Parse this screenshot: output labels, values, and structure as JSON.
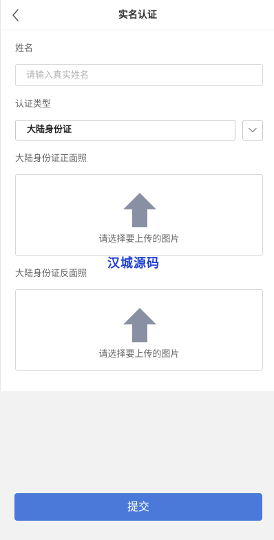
{
  "header": {
    "title": "实名认证"
  },
  "form": {
    "name_label": "姓名",
    "name_placeholder": "请输入真实姓名",
    "type_label": "认证类型",
    "type_value": "大陆身份证",
    "front_label": "大陆身份证正面照",
    "back_label": "大陆身份证反面照",
    "upload_hint": "请选择要上传的图片",
    "upload_icon": "upload-arrow-icon"
  },
  "watermark": "汉城源码",
  "submit_label": "提交",
  "colors": {
    "accent": "#4a79d9",
    "upload_icon": "#8a90a4",
    "watermark": "#1f3fd6",
    "page_background": "#f2f2f2"
  }
}
